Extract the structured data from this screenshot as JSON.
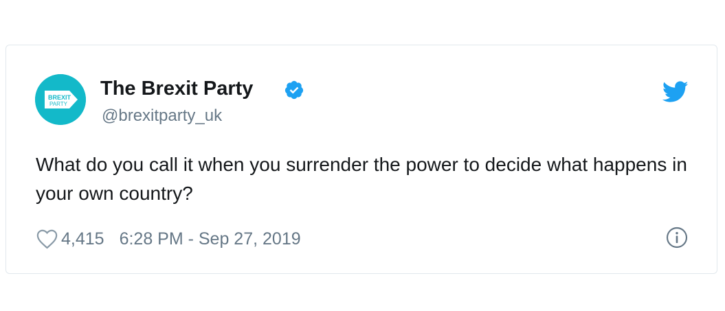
{
  "tweet": {
    "display_name": "The Brexit Party",
    "handle": "@brexitparty_uk",
    "text": "What do you call it when you surrender the power to decide what happens in your own country?",
    "like_count": "4,415",
    "timestamp": "6:28 PM - Sep 27, 2019",
    "avatar": {
      "logo_line_1": "BREXIT",
      "logo_line_2": "PARTY",
      "background_color": "#13b9c9"
    }
  },
  "icons": {
    "verified": "verified-badge-icon",
    "twitter": "twitter-bird-icon",
    "heart": "heart-icon",
    "info": "info-icon"
  },
  "colors": {
    "twitter_blue": "#1da1f2",
    "text_primary": "#14171a",
    "text_secondary": "#657786",
    "border": "#e1e8ed"
  }
}
